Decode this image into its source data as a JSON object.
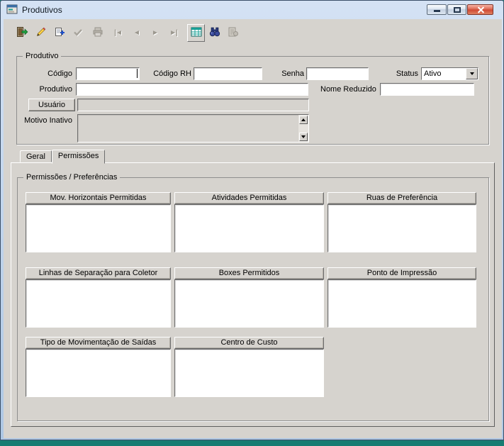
{
  "window": {
    "title": "Produtivos"
  },
  "titlebar": {
    "buttons": [
      "minimize",
      "maximize",
      "close"
    ]
  },
  "toolbar": {
    "buttons": [
      "exit-door-icon",
      "pencil-edit-icon",
      "insert-record-icon",
      "post-record-icon",
      "print-icon",
      "first-record-icon",
      "prior-record-icon",
      "next-record-icon",
      "last-record-icon",
      "data-grid-icon",
      "binoculars-search-icon",
      "report-icon"
    ],
    "nav_glyphs": {
      "first": "|◄",
      "prior": "◄",
      "next": "►",
      "last": "►|"
    }
  },
  "produtivo": {
    "group_title": "Produtivo",
    "codigo_label": "Código",
    "codigo_rh_label": "Código RH",
    "senha_label": "Senha",
    "status_label": "Status",
    "produtivo_label": "Produtivo",
    "nome_reduzido_label": "Nome Reduzido",
    "usuario_button": "Usuário",
    "motivo_inativo_label": "Motivo Inativo",
    "values": {
      "codigo": "",
      "codigo_rh": "",
      "senha": "",
      "status": "Ativo",
      "produtivo": "",
      "nome_reduzido": "",
      "usuario": "",
      "motivo_inativo": ""
    }
  },
  "tabs": [
    {
      "label": "Geral",
      "active": false
    },
    {
      "label": "Permissões",
      "active": true
    }
  ],
  "permissions": {
    "group_title": "Permissões / Preferências",
    "panels": [
      {
        "label": "Mov. Horizontais Permitidas",
        "items": []
      },
      {
        "label": "Atividades Permitidas",
        "items": []
      },
      {
        "label": "Ruas de Preferência",
        "items": []
      },
      {
        "label": "Linhas de Separação para Coletor",
        "items": []
      },
      {
        "label": "Boxes Permitidos",
        "items": []
      },
      {
        "label": "Ponto de Impressão",
        "items": []
      },
      {
        "label": "Tipo de Movimentação de Saídas",
        "items": []
      },
      {
        "label": "Centro de Custo",
        "items": []
      }
    ]
  },
  "colors": {
    "titlebar_gradient_top": "#d4e2f4",
    "titlebar_gradient_bottom": "#aec7e4",
    "close_button_red": "#cf4a35",
    "window_face_gray": "#d6d3ce",
    "desktop_teal": "#177c72",
    "grid_icon_teal": "#18a096"
  }
}
